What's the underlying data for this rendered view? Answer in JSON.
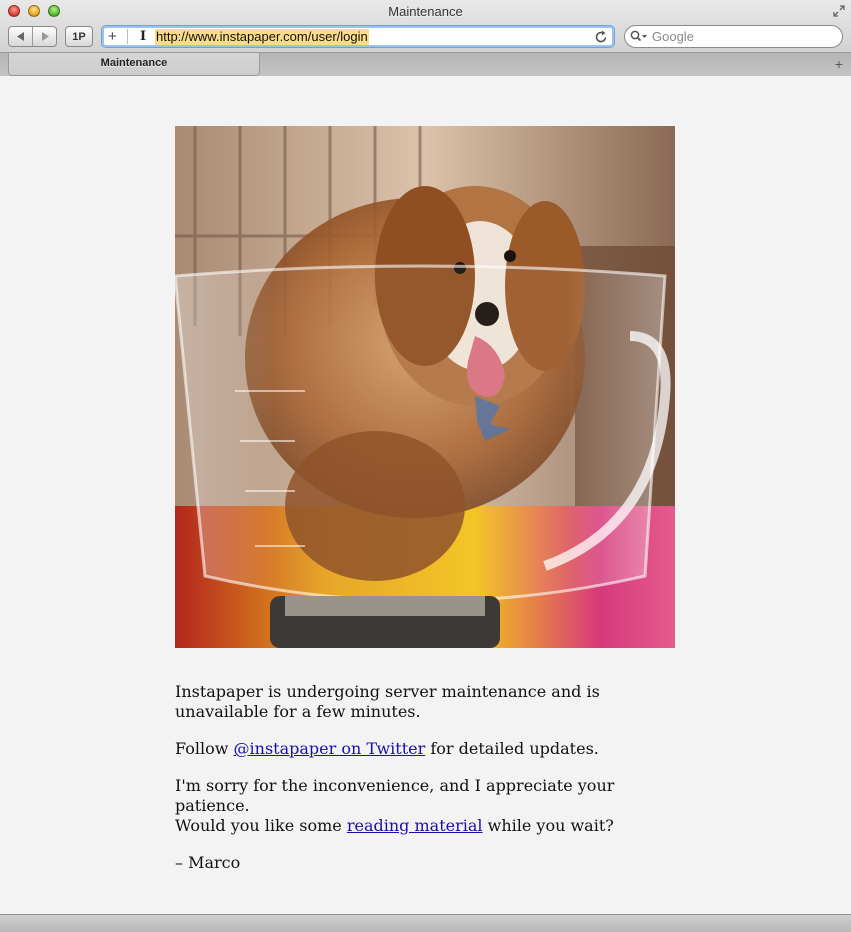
{
  "window": {
    "title": "Maintenance"
  },
  "toolbar": {
    "onepassword_label": "1P",
    "url_add_label": "+",
    "url": "http://www.instapaper.com/user/login",
    "search_placeholder": "Google"
  },
  "tabs": [
    {
      "label": "Maintenance"
    }
  ],
  "newtab_label": "+",
  "page": {
    "image_alt": "Puppy sitting in a glass mixing bowl",
    "p1": "Instapaper is undergoing server maintenance and is unavailable for a few minutes.",
    "p2_before": "Follow ",
    "p2_link": "@instapaper on Twitter",
    "p2_after": " for detailed updates.",
    "p3_line1": "I'm sorry for the inconvenience, and I appreciate your patience.",
    "p3_before": "Would you like some ",
    "p3_link": "reading material",
    "p3_after": " while you wait?",
    "signature": "– Marco"
  },
  "colors": {
    "link": "#1a0dab",
    "url_highlight": "#fcdb8a",
    "page_background": "#f3f3f3"
  }
}
